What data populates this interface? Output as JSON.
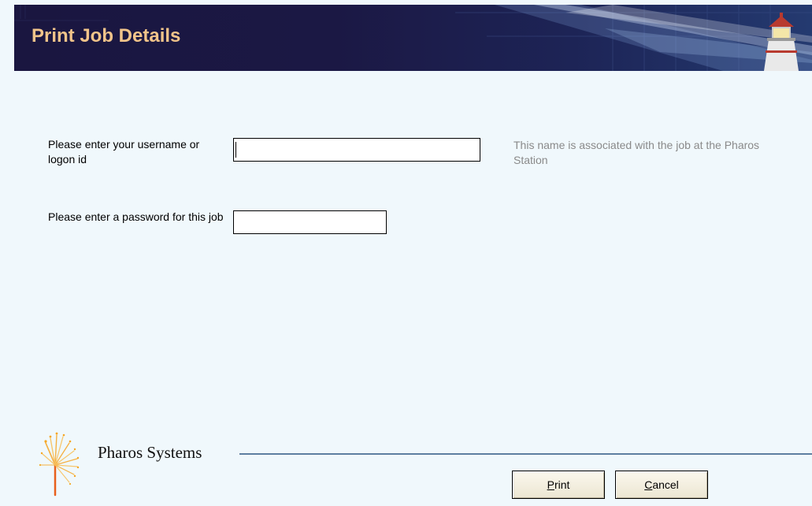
{
  "header": {
    "title": "Print Job Details"
  },
  "form": {
    "username_label": "Please enter your username or logon id",
    "username_value": "",
    "username_hint": "This name is associated with the job at the Pharos Station",
    "password_label": "Please enter a password for this job",
    "password_value": ""
  },
  "footer": {
    "brand": "Pharos Systems"
  },
  "buttons": {
    "print": {
      "accel": "P",
      "rest": "rint"
    },
    "cancel": {
      "accel": "C",
      "rest": "ancel"
    }
  },
  "colors": {
    "background": "#f0f8fc",
    "header": "#1a1640",
    "title": "#f1c48a",
    "hint": "#8a8a8a",
    "rule": "#5d7ea0",
    "button": "#f3efe0"
  },
  "icons": {
    "header_art": "lighthouse-icon",
    "logo": "pharos-starburst-logo"
  }
}
